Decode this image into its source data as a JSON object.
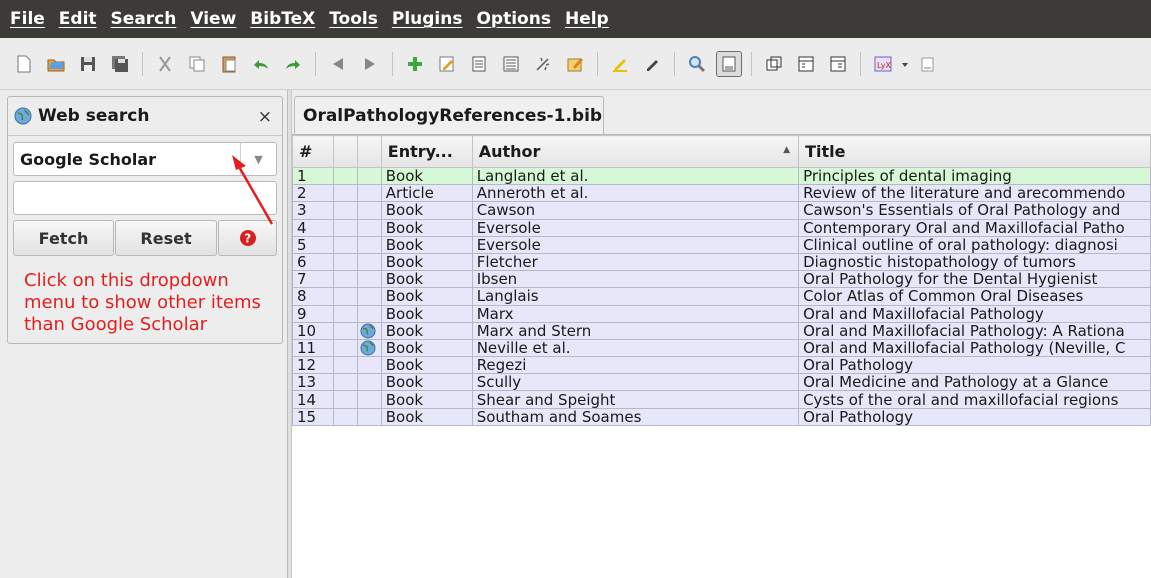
{
  "menu": [
    "File",
    "Edit",
    "Search",
    "View",
    "BibTeX",
    "Tools",
    "Plugins",
    "Options",
    "Help"
  ],
  "toolbar_icons": [
    "new-file-icon",
    "open-folder-icon",
    "save-icon",
    "save-all-icon",
    "cut-icon",
    "copy-icon",
    "paste-icon",
    "undo-icon",
    "redo-icon",
    "back-icon",
    "forward-icon",
    "add-entry-icon",
    "edit-entry-icon",
    "new-doc-icon",
    "preview-icon",
    "cleanup-icon",
    "edit-strings-icon",
    "highlight-icon",
    "mark-icon",
    "search-icon",
    "toggle-panel-icon",
    "copy-key-icon",
    "open-pdf-icon",
    "open-url-icon",
    "lyx-icon",
    "dropdown-icon",
    "doc-icon"
  ],
  "web_search": {
    "title": "Web search",
    "close": "×",
    "engine": "Google Scholar",
    "query_placeholder": "",
    "fetch_label": "Fetch",
    "reset_label": "Reset"
  },
  "annotation": "Click on this dropdown menu to show other items than Google Scholar",
  "file_tab": "OralPathologyReferences-1.bib",
  "table": {
    "columns": [
      "#",
      "",
      "",
      "Entry...",
      "Author",
      "Title"
    ],
    "sort_indicator": "▲",
    "rows": [
      {
        "num": "1",
        "globe": false,
        "type": "Book",
        "author": "Langland et al.",
        "title": "Principles of dental imaging"
      },
      {
        "num": "2",
        "globe": false,
        "type": "Article",
        "author": "Anneroth et al.",
        "title": "Review of the literature and arecommendo"
      },
      {
        "num": "3",
        "globe": false,
        "type": "Book",
        "author": "Cawson",
        "title": "Cawson's Essentials of Oral Pathology and"
      },
      {
        "num": "4",
        "globe": false,
        "type": "Book",
        "author": "Eversole",
        "title": "Contemporary Oral and Maxillofacial Patho"
      },
      {
        "num": "5",
        "globe": false,
        "type": "Book",
        "author": "Eversole",
        "title": "Clinical outline of oral pathology: diagnosi"
      },
      {
        "num": "6",
        "globe": false,
        "type": "Book",
        "author": "Fletcher",
        "title": "Diagnostic histopathology of tumors"
      },
      {
        "num": "7",
        "globe": false,
        "type": "Book",
        "author": "Ibsen",
        "title": "Oral Pathology for the Dental Hygienist"
      },
      {
        "num": "8",
        "globe": false,
        "type": "Book",
        "author": "Langlais",
        "title": "Color Atlas of Common Oral Diseases"
      },
      {
        "num": "9",
        "globe": false,
        "type": "Book",
        "author": "Marx",
        "title": "Oral and Maxillofacial Pathology"
      },
      {
        "num": "10",
        "globe": true,
        "type": "Book",
        "author": "Marx and Stern",
        "title": "Oral and Maxillofacial Pathology: A Rationa"
      },
      {
        "num": "11",
        "globe": true,
        "type": "Book",
        "author": "Neville et al.",
        "title": "Oral and Maxillofacial Pathology (Neville, C"
      },
      {
        "num": "12",
        "globe": false,
        "type": "Book",
        "author": "Regezi",
        "title": "Oral Pathology"
      },
      {
        "num": "13",
        "globe": false,
        "type": "Book",
        "author": "Scully",
        "title": "Oral Medicine and Pathology at a Glance"
      },
      {
        "num": "14",
        "globe": false,
        "type": "Book",
        "author": "Shear and Speight",
        "title": "Cysts of the oral and maxillofacial regions"
      },
      {
        "num": "15",
        "globe": false,
        "type": "Book",
        "author": "Southam and Soames",
        "title": "Oral Pathology"
      }
    ]
  },
  "colors": {
    "menubar_bg": "#3c3b37",
    "row_bg": "#e6e8fa",
    "selected_row_bg": "#d7f8d7",
    "annotation": "#e21f1f"
  }
}
